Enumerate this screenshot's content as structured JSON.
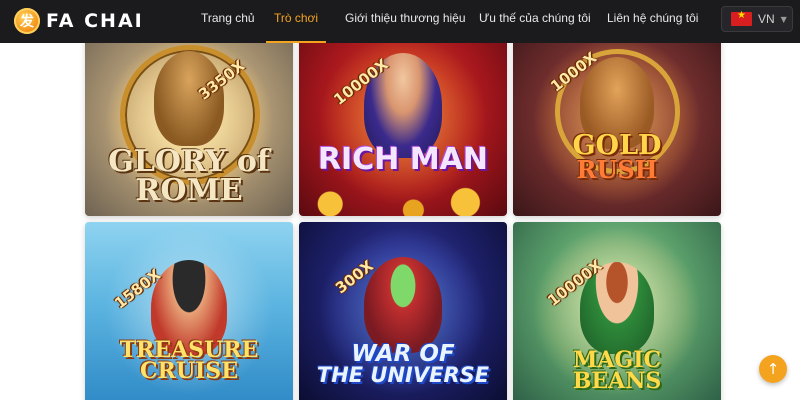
{
  "brand": {
    "logo_glyph": "发",
    "name": "FA CHAI"
  },
  "nav": {
    "items": [
      {
        "label": "Trang chủ",
        "active": false
      },
      {
        "label": "Trò chơi",
        "active": true
      },
      {
        "label": "Giới thiệu thương hiệu",
        "active": false
      },
      {
        "label": "Ưu thế của chúng tôi",
        "active": false
      },
      {
        "label": "Liên hệ chúng tôi",
        "active": false
      }
    ]
  },
  "language": {
    "flag_icon": "vietnam-flag-icon",
    "code": "VN",
    "caret_icon": "caret-down-icon"
  },
  "games": [
    {
      "multiplier": "3350X",
      "title_line1": "GLORY of",
      "title_line2": "ROME"
    },
    {
      "multiplier": "10000X",
      "title_line1": "RICH MAN",
      "title_line2": ""
    },
    {
      "multiplier": "1000X",
      "title_line1": "GOLD",
      "title_line2": "RUSH"
    },
    {
      "multiplier": "1580X",
      "title_line1": "TREASURE",
      "title_line2": "CRUISE"
    },
    {
      "multiplier": "300X",
      "title_line1": "WAR OF",
      "title_line2": "THE UNIVERSE"
    },
    {
      "multiplier": "10000X",
      "title_line1": "MAGIC",
      "title_line2": "BEANS"
    }
  ],
  "scroll_top": {
    "icon": "arrow-up-icon",
    "glyph": "↑"
  },
  "colors": {
    "header_bg": "#1b1b1d",
    "accent": "#f4a31e",
    "page_bg": "#ffffff"
  }
}
